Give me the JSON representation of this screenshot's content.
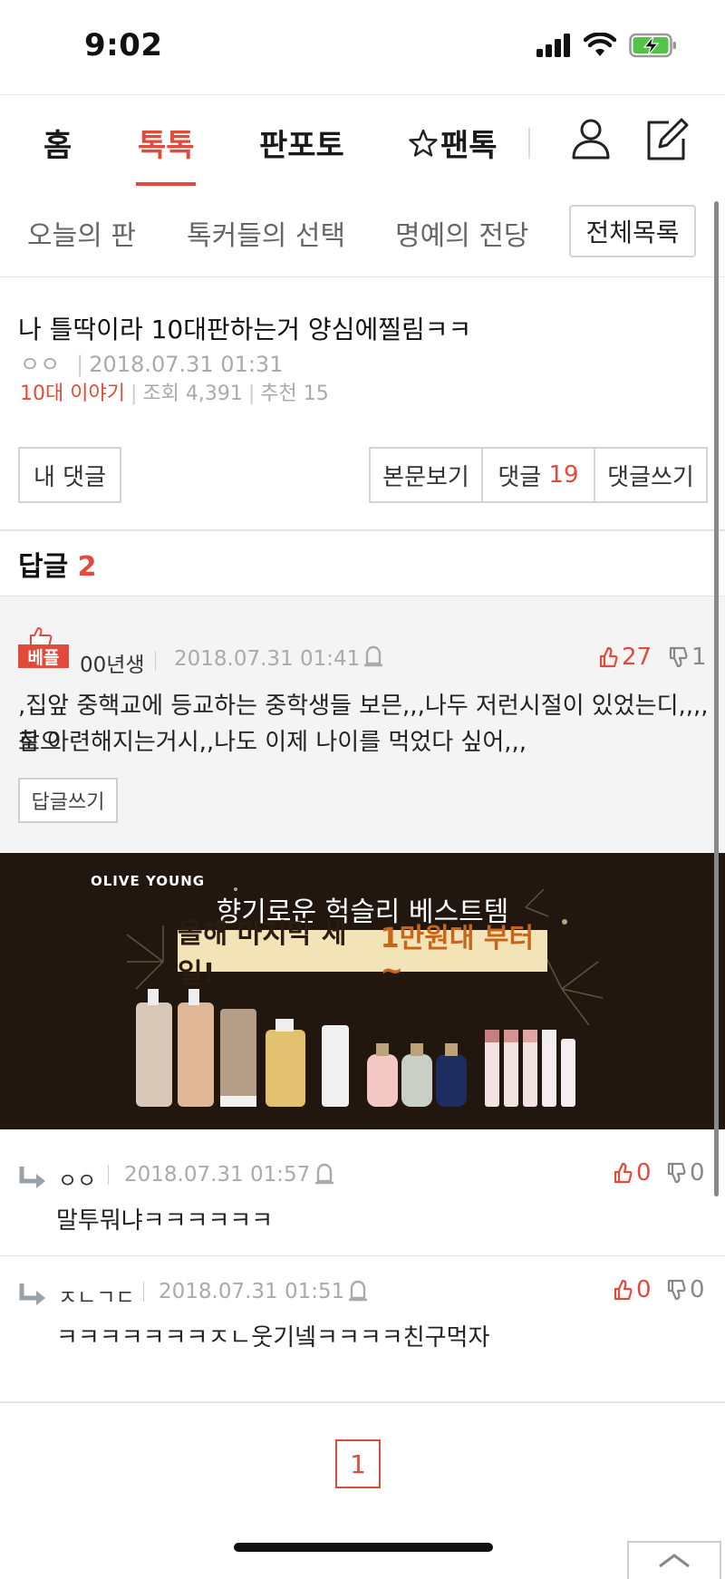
{
  "status_bar": {
    "time": "9:02"
  },
  "top_nav": {
    "tabs": [
      "홈",
      "톡톡",
      "판포토",
      "팬톡"
    ],
    "active": "톡톡"
  },
  "sub_nav": {
    "tabs": [
      "오늘의 판",
      "톡커들의 선택",
      "명예의 전당"
    ],
    "all_list": "전체목록"
  },
  "post": {
    "title": "나 틀딱이라 10대판하는거 양심에찔림ㅋㅋ",
    "author": "ㅇㅇ",
    "datetime": "2018.07.31 01:31",
    "category": "10대 이야기",
    "views_label": "조회",
    "views": "4,391",
    "recommend_label": "추천",
    "recommend": "15"
  },
  "actions": {
    "my_comments": "내 댓글",
    "view_body": "본문보기",
    "comments_label": "댓글",
    "comments_count": "19",
    "write_comment": "댓글쓰기"
  },
  "replies_header": {
    "label": "답글",
    "count": "2"
  },
  "best_comment": {
    "badge": "베플",
    "author": "00년생",
    "datetime": "2018.07.31 01:41",
    "text_line1": ",집앞 중핵교에 등교하는 중학생들 보믄,,,나두 저런시절이 있었는디,,,,참으",
    "text_line2": "로 아련해지는거시,,나도 이제 나이를 먹었다 싶어,,,",
    "likes": "27",
    "dislikes": "1",
    "reply_button": "답글쓰기"
  },
  "ad": {
    "brand": "OLIVE YOUNG",
    "title": "향기로운 헉슬리 베스트템",
    "sub_prefix": "올해 마지막 세일! ",
    "sub_highlight": "1만원대 부터~"
  },
  "sub_replies": [
    {
      "author": "ㅇㅇ",
      "datetime": "2018.07.31 01:57",
      "text": "말투뭐냐ㅋㅋㅋㅋㅋㅋ",
      "likes": "0",
      "dislikes": "0"
    },
    {
      "author": "ㅈㄴㄱㄷ",
      "datetime": "2018.07.31 01:51",
      "text": "ㅋㅋㅋㅋㅋㅋㅋㅈㄴ웃기넼ㅋㅋㅋㅋ친구먹자",
      "likes": "0",
      "dislikes": "0"
    }
  ],
  "pagination": {
    "current": "1"
  },
  "colors": {
    "accent": "#e24b3b",
    "ad_bg": "#22170f",
    "best_bg": "#f4f4f4"
  }
}
